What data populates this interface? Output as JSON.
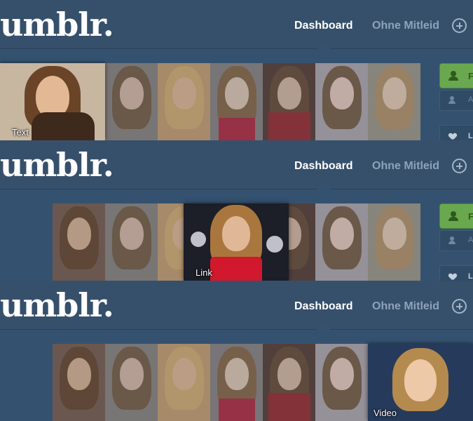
{
  "header": {
    "logo": "umblr.",
    "nav": {
      "dashboard": "Dashboard",
      "blog": "Ohne Mitleid"
    },
    "new_post_icon": "plus-circle-icon"
  },
  "sidebar": {
    "follow_letter": "F",
    "sub_letter": "A",
    "like_letter": "L"
  },
  "panels": [
    {
      "label": "Text",
      "active_index": 0
    },
    {
      "label": "Link",
      "active_index": 3
    },
    {
      "label": "Video",
      "active_index": 7
    }
  ],
  "colors": {
    "background": "#2c4762",
    "header": "#36506b",
    "nav_active": "#ffffff",
    "nav_inactive": "#8da3ba",
    "follow_green": "#6aa84f"
  }
}
